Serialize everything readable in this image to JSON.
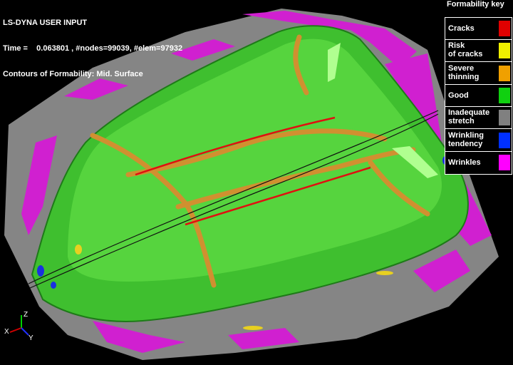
{
  "header": {
    "title": "LS-DYNA USER INPUT",
    "time_line": "Time =    0.063801 , #nodes=99039, #elem=97932",
    "contours_line": "Contours of Formability: Mid. Surface"
  },
  "legend": {
    "title": "Formability key",
    "items": [
      {
        "line1": "Cracks",
        "line2": "",
        "color": "#e00000"
      },
      {
        "line1": "Risk",
        "line2": "of cracks",
        "color": "#f0f000"
      },
      {
        "line1": "Severe",
        "line2": "thinning",
        "color": "#f0a000"
      },
      {
        "line1": "Good",
        "line2": "",
        "color": "#10d010"
      },
      {
        "line1": "Inadequate",
        "line2": "stretch",
        "color": "#808080"
      },
      {
        "line1": "Wrinkling",
        "line2": "tendency",
        "color": "#0030ff"
      },
      {
        "line1": "Wrinkles",
        "line2": "",
        "color": "#ff00ff"
      }
    ]
  },
  "axes": {
    "z": "Z",
    "x": "X",
    "y": "Y"
  }
}
